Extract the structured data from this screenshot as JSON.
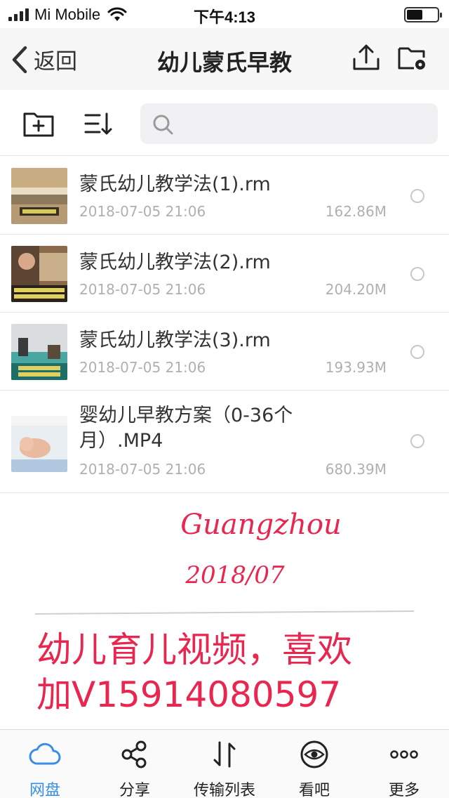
{
  "status_bar": {
    "carrier": "Mi Mobile",
    "time": "下午4:13"
  },
  "nav": {
    "back_label": "返回",
    "title": "幼儿蒙氏早教",
    "upload_icon": "upload-icon",
    "folder_settings_icon": "folder-settings-icon"
  },
  "toolbar": {
    "new_folder_icon": "new-folder-icon",
    "sort_icon": "sort-icon",
    "search_placeholder": ""
  },
  "files": [
    {
      "name": "蒙氏幼儿教学法(1).rm",
      "date": "2018-07-05 21:06",
      "size": "162.86M"
    },
    {
      "name": "蒙氏幼儿教学法(2).rm",
      "date": "2018-07-05 21:06",
      "size": "204.20M"
    },
    {
      "name": "蒙氏幼儿教学法(3).rm",
      "date": "2018-07-05 21:06",
      "size": "193.93M"
    },
    {
      "name": "婴幼儿早教方案（0-36个月）.MP4",
      "date": "2018-07-05 21:06",
      "size": "680.39M"
    }
  ],
  "overlay": {
    "city": "Guangzhou",
    "date": "2018/07",
    "line1": "幼儿育儿视频，喜欢",
    "line2": "加V15914080597"
  },
  "tabs": [
    {
      "label": "网盘",
      "icon": "cloud-icon",
      "active": true
    },
    {
      "label": "分享",
      "icon": "share-icon",
      "active": false
    },
    {
      "label": "传输列表",
      "icon": "transfer-icon",
      "active": false
    },
    {
      "label": "看吧",
      "icon": "eye-icon",
      "active": false
    },
    {
      "label": "更多",
      "icon": "more-icon",
      "active": false
    }
  ],
  "colors": {
    "accent": "#3a8ee6",
    "handwriting": "#e8264f"
  }
}
